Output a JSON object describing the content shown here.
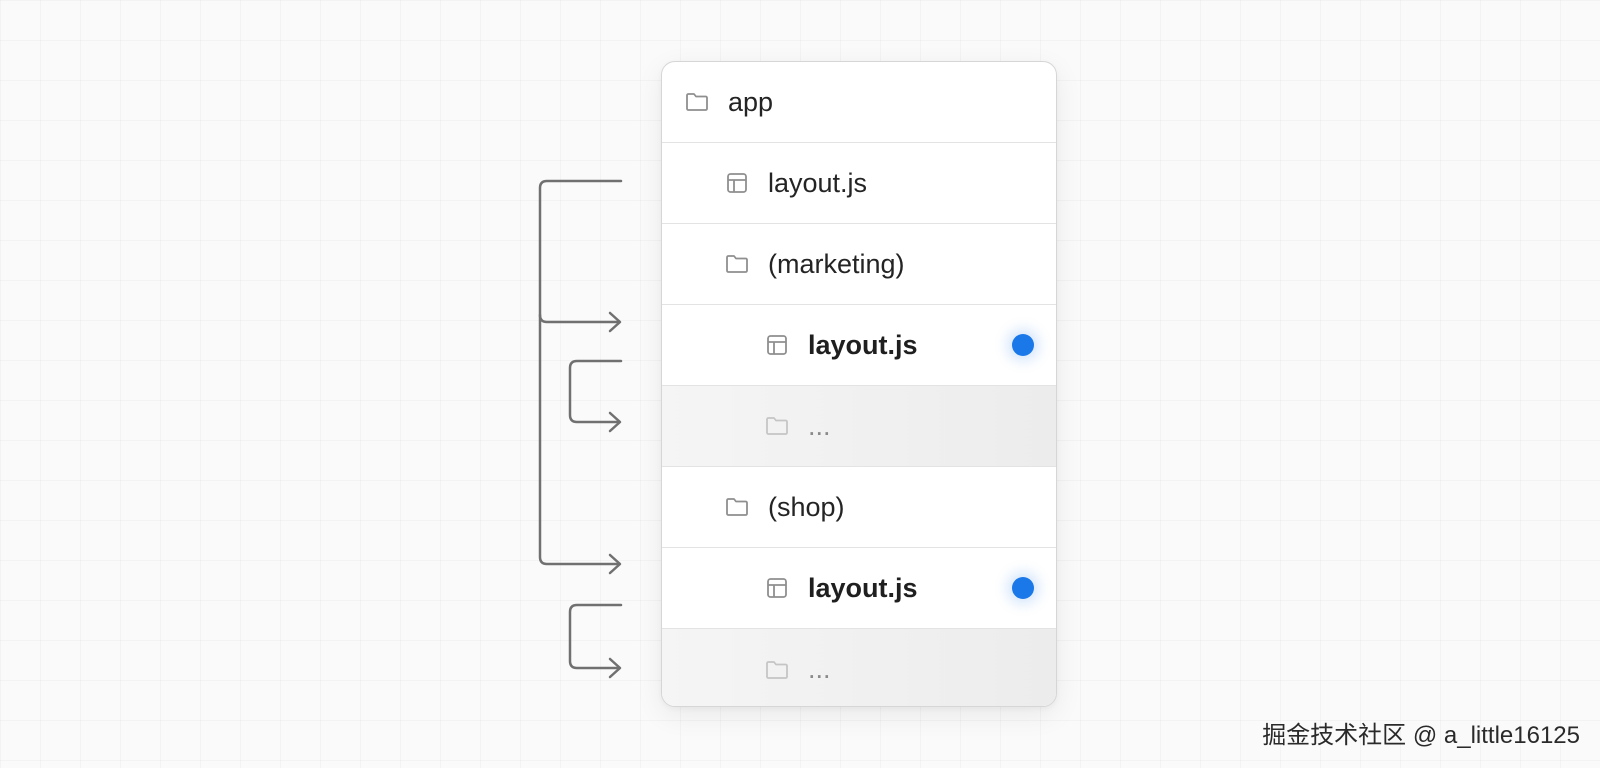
{
  "tree": {
    "items": [
      {
        "label": "app",
        "icon": "folder-icon",
        "style": "normal",
        "marked": false
      },
      {
        "label": "layout.js",
        "icon": "layout-file-icon",
        "style": "normal",
        "marked": false
      },
      {
        "label": "(marketing)",
        "icon": "folder-icon",
        "style": "normal",
        "marked": false
      },
      {
        "label": "layout.js",
        "icon": "layout-file-icon",
        "style": "bold",
        "marked": true
      },
      {
        "label": "...",
        "icon": "folder-icon",
        "style": "dim",
        "marked": false
      },
      {
        "label": "(shop)",
        "icon": "folder-icon",
        "style": "normal",
        "marked": false
      },
      {
        "label": "layout.js",
        "icon": "layout-file-icon",
        "style": "bold",
        "marked": true
      },
      {
        "label": "...",
        "icon": "folder-icon",
        "style": "dim",
        "marked": false
      }
    ]
  },
  "colors": {
    "marker": "#1a78e9",
    "connector": "#707070",
    "icon": "#8f8f8f"
  },
  "watermark": "掘金技术社区 @ a_little16125"
}
